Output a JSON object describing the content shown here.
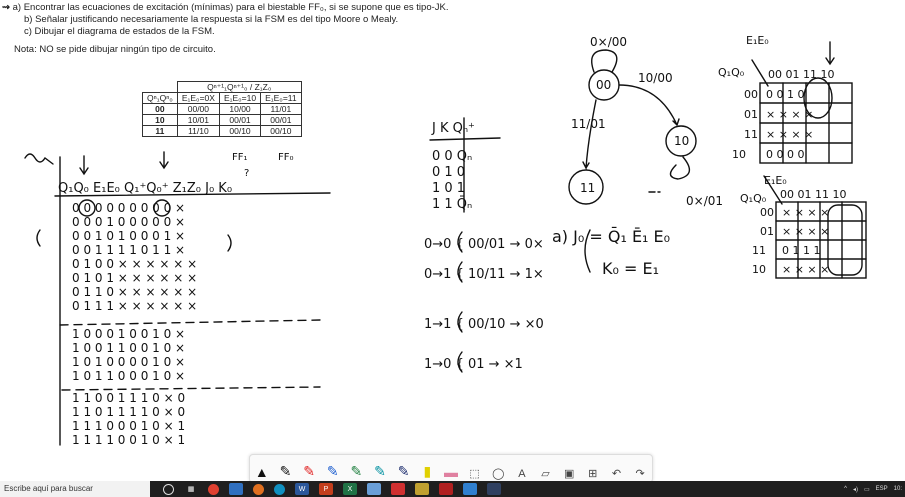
{
  "instructions": {
    "a": "a)  Encontrar las ecuaciones de excitación (mínimas) para el biestable FF₀, si se supone que es tipo-JK.",
    "b": "b)  Señalar justificando necesariamente la respuesta si la FSM es del tipo Moore o Mealy.",
    "c": "c)  Dibujar el diagrama de estados de la FSM.",
    "note": "Nota: NO se pide dibujar ningún tipo de circuito."
  },
  "state_table": {
    "title": "Qⁿ⁺¹₁Qⁿ⁺¹₀ / Z₁Z₀",
    "row_header": "Qⁿ₁Qⁿ₀",
    "columns": [
      "E₁E₀=0X",
      "E₁E₀=10",
      "E₁E₀=11"
    ],
    "rows": [
      {
        "state": "00",
        "cells": [
          "00/00",
          "10/00",
          "11/01"
        ]
      },
      {
        "state": "10",
        "cells": [
          "10/01",
          "00/01",
          "00/01"
        ]
      },
      {
        "state": "11",
        "cells": [
          "11/10",
          "00/10",
          "00/10"
        ]
      }
    ]
  },
  "handwriting": {
    "table_header": "Q₁Q₀ E₁E₀  Q₁⁺Q₀⁺  Z₁Z₀   J₀ K₀",
    "jk_header": "J K  Qₙ⁺",
    "jk_rows": [
      "0 0  Qₙ",
      "0 1  0",
      "1 0  1",
      "1 1  Q̄ₙ"
    ],
    "eq_j": "a) J₀ = Q̄₁ Ē₁ E₀",
    "eq_k": "K₀ = E₁",
    "transitions": [
      "0→0 { 00/01 → 0×",
      "0→1 { 10/11 → 1×",
      "1→1 { 00/10 → ×0",
      "1→0 { 01 → ×1"
    ]
  },
  "toolbar": {
    "tools": [
      "cursor",
      "pen-black",
      "pen-red",
      "pen-blue",
      "pen-green",
      "pen-teal",
      "pen-navy",
      "highlighter",
      "eraser",
      "lasso",
      "shape",
      "text",
      "ruler",
      "image",
      "add",
      "undo",
      "redo"
    ]
  },
  "taskbar": {
    "search_placeholder": "Escribe aquí para buscar",
    "lang": "ESP",
    "time": "10:"
  }
}
